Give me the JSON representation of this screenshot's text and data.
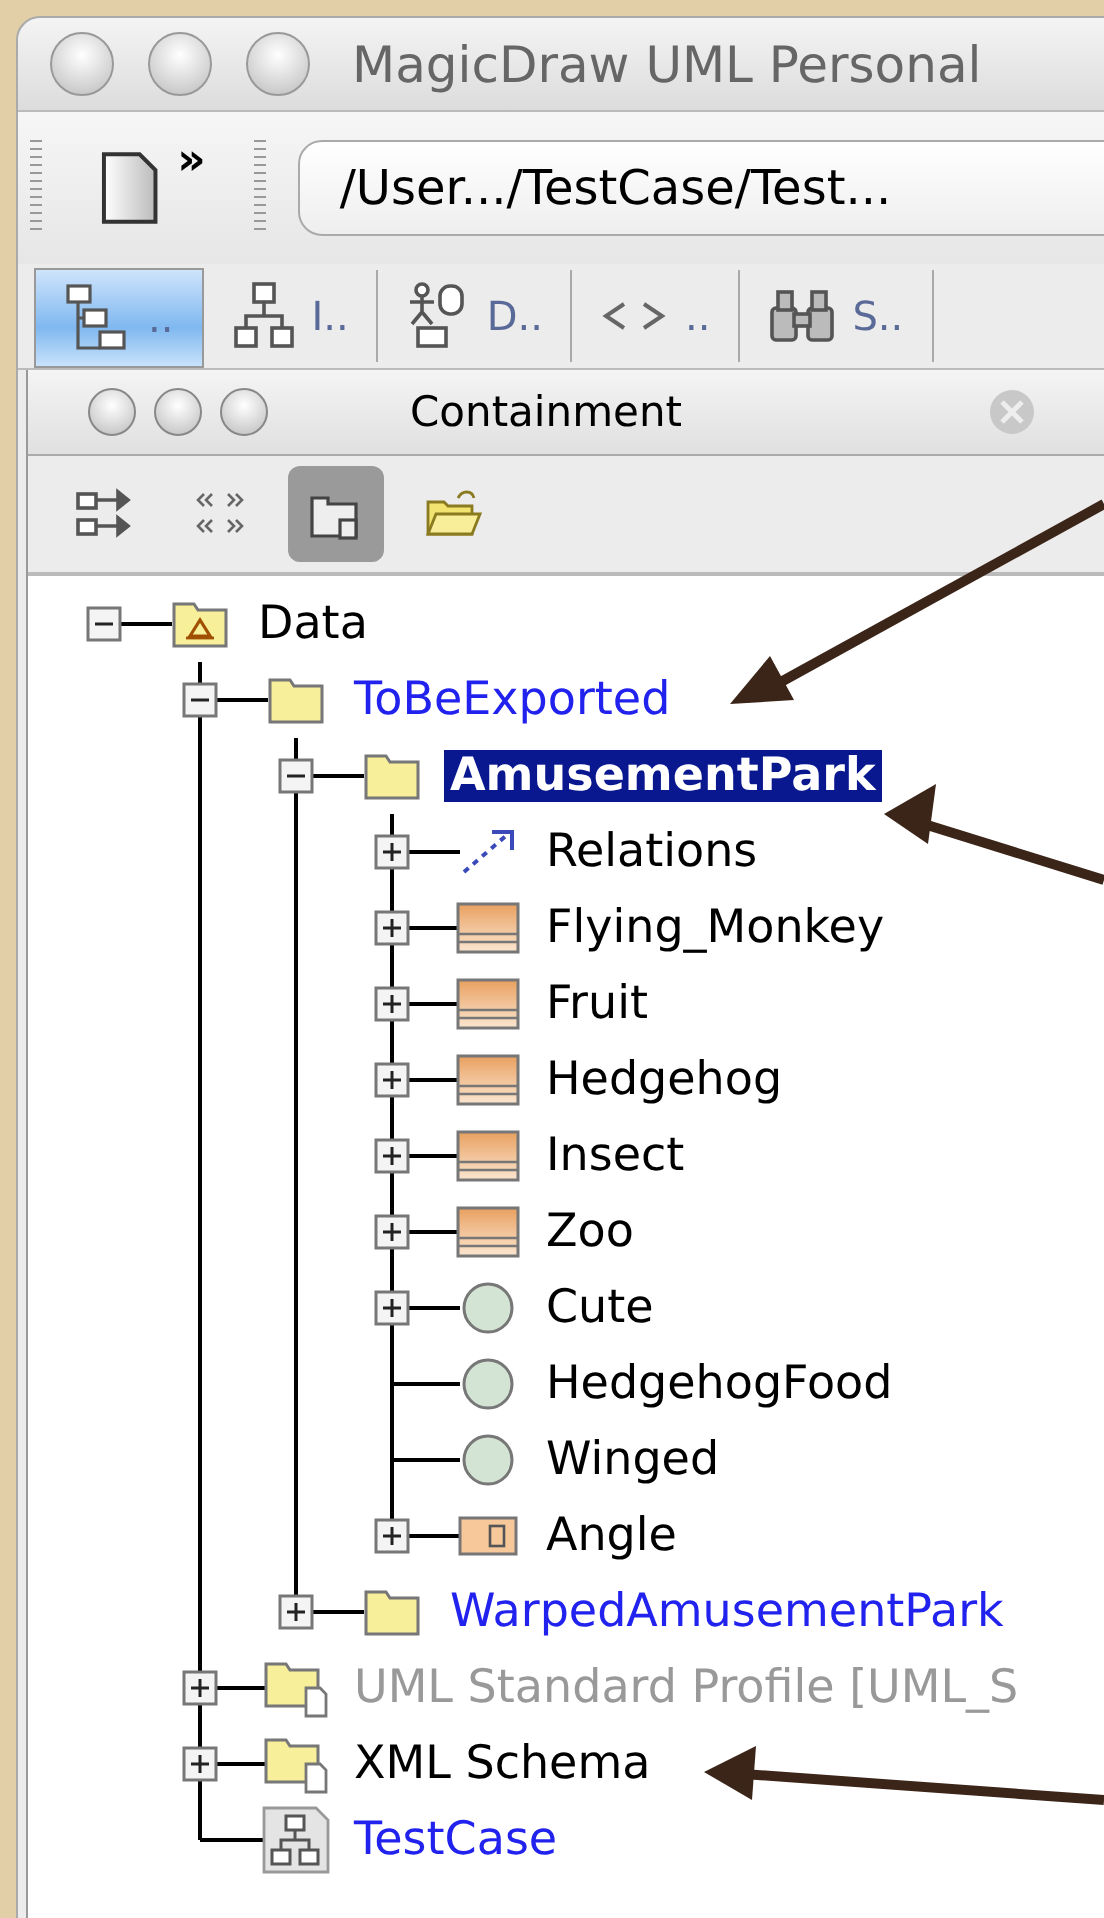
{
  "window": {
    "title": "MagicDraw UML Personal"
  },
  "toolbar": {
    "overflow": "»",
    "path": "/User.../TestCase/Test..."
  },
  "tabs": [
    {
      "kind": "tree",
      "label": "..",
      "selected": true
    },
    {
      "kind": "hierarchy",
      "label": "I..",
      "selected": false
    },
    {
      "kind": "diagram",
      "label": "D..",
      "selected": false
    },
    {
      "kind": "code",
      "label": "..",
      "selected": false
    },
    {
      "kind": "binoculars",
      "label": "S..",
      "selected": false
    }
  ],
  "panel": {
    "title": "Containment",
    "tools": [
      {
        "kind": "arrange",
        "selected": false
      },
      {
        "kind": "stereotype",
        "selected": false
      },
      {
        "kind": "package-view",
        "selected": true
      },
      {
        "kind": "open-folder",
        "selected": false
      }
    ]
  },
  "tree": [
    {
      "kind": "model",
      "label": "Data",
      "color": "#000000",
      "selected": false,
      "expanded": true,
      "children": [
        {
          "kind": "package",
          "label": "ToBeExported",
          "color": "#2222ee",
          "selected": false,
          "expanded": true,
          "children": [
            {
              "kind": "package",
              "label": "AmusementPark",
              "selected": true,
              "expanded": true,
              "children": [
                {
                  "kind": "relations",
                  "label": "Relations",
                  "color": "#000000",
                  "selected": false,
                  "expanded": false
                },
                {
                  "kind": "class",
                  "label": "Flying_Monkey",
                  "color": "#000000",
                  "selected": false,
                  "expanded": false
                },
                {
                  "kind": "class",
                  "label": "Fruit",
                  "color": "#000000",
                  "selected": false,
                  "expanded": false
                },
                {
                  "kind": "class",
                  "label": "Hedgehog",
                  "color": "#000000",
                  "selected": false,
                  "expanded": false
                },
                {
                  "kind": "class",
                  "label": "Insect",
                  "color": "#000000",
                  "selected": false,
                  "expanded": false
                },
                {
                  "kind": "class",
                  "label": "Zoo",
                  "color": "#000000",
                  "selected": false,
                  "expanded": false
                },
                {
                  "kind": "interface",
                  "label": "Cute",
                  "color": "#000000",
                  "selected": false,
                  "expanded": false
                },
                {
                  "kind": "interface",
                  "label": "HedgehogFood",
                  "color": "#000000",
                  "selected": false
                },
                {
                  "kind": "interface",
                  "label": "Winged",
                  "color": "#000000",
                  "selected": false
                },
                {
                  "kind": "datatype",
                  "label": "Angle",
                  "color": "#000000",
                  "selected": false,
                  "expanded": false
                }
              ]
            },
            {
              "kind": "package",
              "label": "WarpedAmusementPark",
              "color": "#2222ee",
              "selected": false,
              "expanded": false
            }
          ]
        },
        {
          "kind": "profile",
          "label": "UML Standard Profile [UML_S",
          "color": "#999999",
          "selected": false,
          "expanded": false
        },
        {
          "kind": "profile",
          "label": "XML Schema",
          "color": "#000000",
          "selected": false,
          "expanded": false
        },
        {
          "kind": "diagram",
          "label": "TestCase",
          "color": "#2222ee",
          "selected": false
        }
      ]
    }
  ]
}
